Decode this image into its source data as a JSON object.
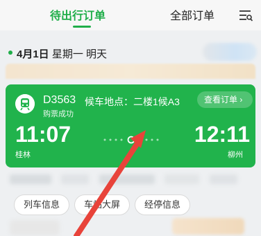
{
  "tabs": {
    "active_label": "待出行订单",
    "all_label": "全部订单"
  },
  "date": {
    "day": "4月1日",
    "weekday": "星期一",
    "relative": "明天"
  },
  "order": {
    "train_no": "D3563",
    "wait_location": "候车地点：二楼1候A3",
    "status": "购票成功",
    "view_button": "查看订单 ›",
    "depart_time": "11:07",
    "depart_station": "桂林",
    "arrive_time": "12:11",
    "arrive_station": "柳州"
  },
  "actions": {
    "train_info": "列车信息",
    "screen": "车站大屏",
    "stops": "经停信息"
  },
  "colors": {
    "accent": "#1fae49",
    "card": "#21b34c",
    "annotation_arrow": "#e8433a"
  },
  "icons": {
    "filter": "filter-list-icon",
    "train": "train-icon",
    "route": "route-dots-icon"
  }
}
